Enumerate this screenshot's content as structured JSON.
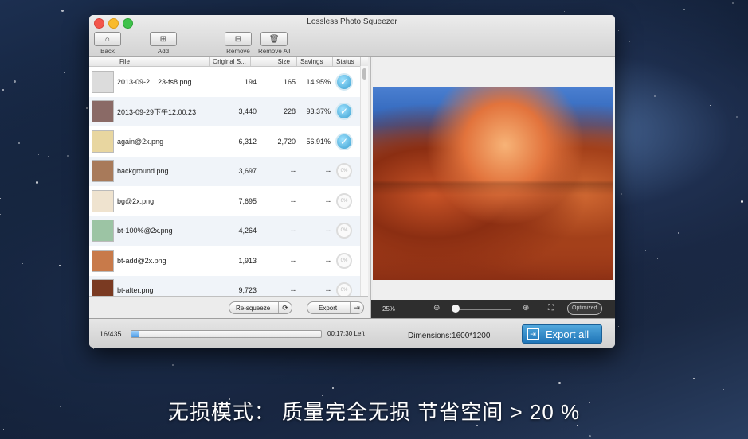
{
  "window": {
    "title": "Lossless Photo Squeezer"
  },
  "toolbar": {
    "back_label": "Back",
    "add_label": "Add",
    "remove_label": "Remove",
    "remove_all_label": "Remove All"
  },
  "list": {
    "columns": [
      "File",
      "Original S...",
      "Size",
      "Savings",
      "Status"
    ],
    "rows": [
      {
        "name": "2013-09-2....23-fs8.png",
        "original": "194",
        "size": "165",
        "savings": "14.95%",
        "status": "done",
        "thumb_color": "#dcdcdc"
      },
      {
        "name": "2013-09-29下午12.00.23",
        "original": "3,440",
        "size": "228",
        "savings": "93.37%",
        "status": "done",
        "thumb_color": "#8a6a66"
      },
      {
        "name": "again@2x.png",
        "original": "6,312",
        "size": "2,720",
        "savings": "56.91%",
        "status": "done",
        "thumb_color": "#e8d6a0"
      },
      {
        "name": "background.png",
        "original": "3,697",
        "size": "--",
        "savings": "--",
        "status": "0%",
        "thumb_color": "#a87a5a"
      },
      {
        "name": "bg@2x.png",
        "original": "7,695",
        "size": "--",
        "savings": "--",
        "status": "0%",
        "thumb_color": "#efe3cf"
      },
      {
        "name": "bt-100%@2x.png",
        "original": "4,264",
        "size": "--",
        "savings": "--",
        "status": "0%",
        "thumb_color": "#9cc4a4"
      },
      {
        "name": "bt-add@2x.png",
        "original": "1,913",
        "size": "--",
        "savings": "--",
        "status": "0%",
        "thumb_color": "#c87a4a"
      },
      {
        "name": "bt-after.png",
        "original": "9,723",
        "size": "--",
        "savings": "--",
        "status": "0%",
        "thumb_color": "#7a3a22"
      }
    ]
  },
  "actions": {
    "resqueeze_label": "Re-squeeze",
    "export_label": "Export"
  },
  "preview": {
    "zoom": "25%",
    "optimized_label": "Optimized"
  },
  "status": {
    "count": "16/435",
    "progress": 0.0368,
    "time_left": "00:17:30 Left",
    "dimensions": "Dimensions:1600*1200",
    "export_all_label": "Export all"
  },
  "caption": "无损模式： 质量完全无损 节省空间 > 20 %"
}
